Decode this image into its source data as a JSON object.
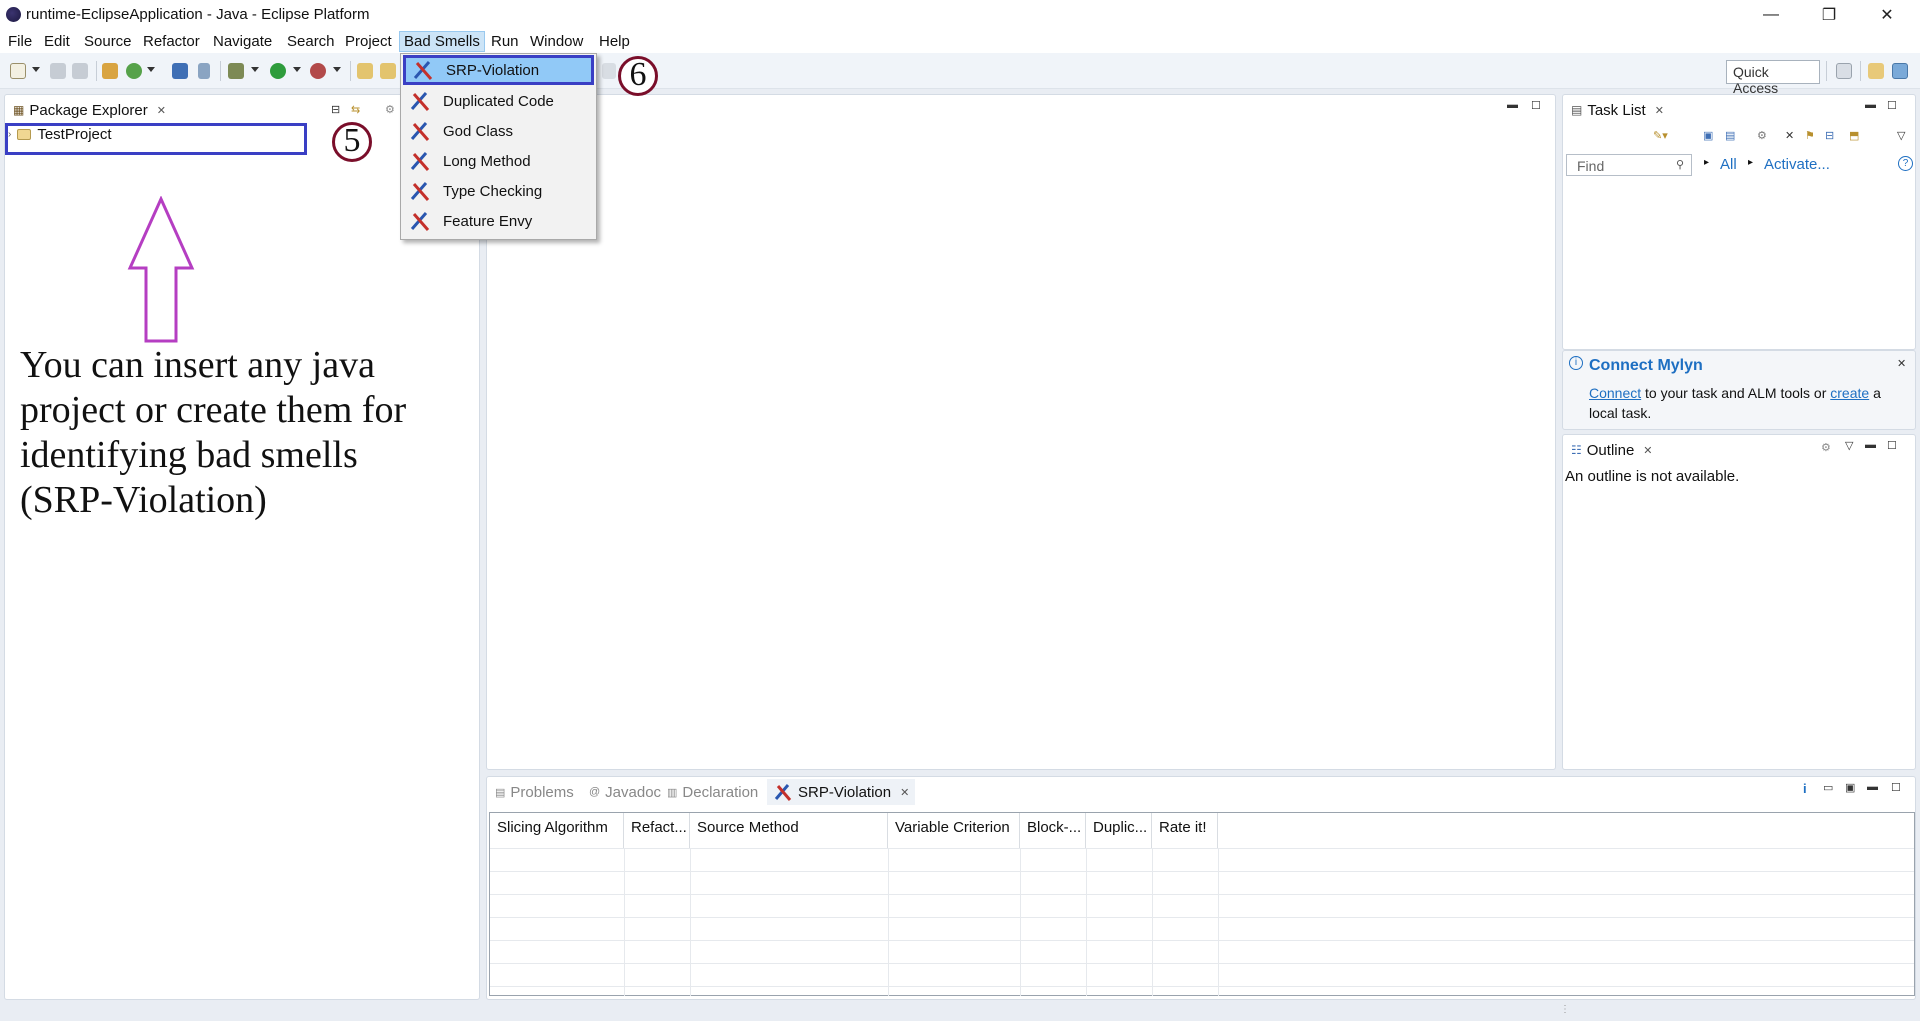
{
  "window": {
    "title": "runtime-EclipseApplication - Java - Eclipse Platform",
    "minimize": "—",
    "restore": "❐",
    "close": "✕"
  },
  "menubar": {
    "items": [
      "File",
      "Edit",
      "Source",
      "Refactor",
      "Navigate",
      "Search",
      "Project",
      "Bad Smells",
      "Run",
      "Window",
      "Help"
    ],
    "active": "Bad Smells"
  },
  "toolbar": {
    "quick_access": "Quick Access"
  },
  "bad_smells_menu": {
    "items": [
      "SRP-Violation",
      "Duplicated Code",
      "God Class",
      "Long Method",
      "Type Checking",
      "Feature Envy"
    ],
    "selected": "SRP-Violation"
  },
  "package_explorer": {
    "tab_label": "Package Explorer",
    "tree": [
      {
        "label": "TestProject",
        "expanded": false
      }
    ]
  },
  "annotations": {
    "step5": "5",
    "step6": "6",
    "note": "You can insert any java project or create them for identifying bad smells (SRP-Violation)",
    "arrow_color": "#b53ec2",
    "box_color": "#3a3fc4"
  },
  "task_list": {
    "tab_label": "Task List",
    "find_placeholder": "Find",
    "all_label": "All",
    "activate_label": "Activate...",
    "help": "?"
  },
  "mylyn": {
    "title": "Connect Mylyn",
    "connect_link": "Connect",
    "text_mid": "to your task and ALM tools or",
    "create_link": "create",
    "text_end": "a",
    "text_line2": "local task."
  },
  "outline": {
    "tab_label": "Outline",
    "message": "An outline is not available."
  },
  "bottom_panel": {
    "tabs": [
      "Problems",
      "Javadoc",
      "Declaration",
      "SRP-Violation"
    ],
    "active_tab": "SRP-Violation",
    "info": "i",
    "columns": [
      "Slicing Algorithm",
      "Refact...",
      "Source Method",
      "Variable Criterion",
      "Block-...",
      "Duplic...",
      "Rate it!"
    ]
  },
  "colors": {
    "link": "#1e6fc2",
    "menu_highlight": "#91c9f7"
  }
}
